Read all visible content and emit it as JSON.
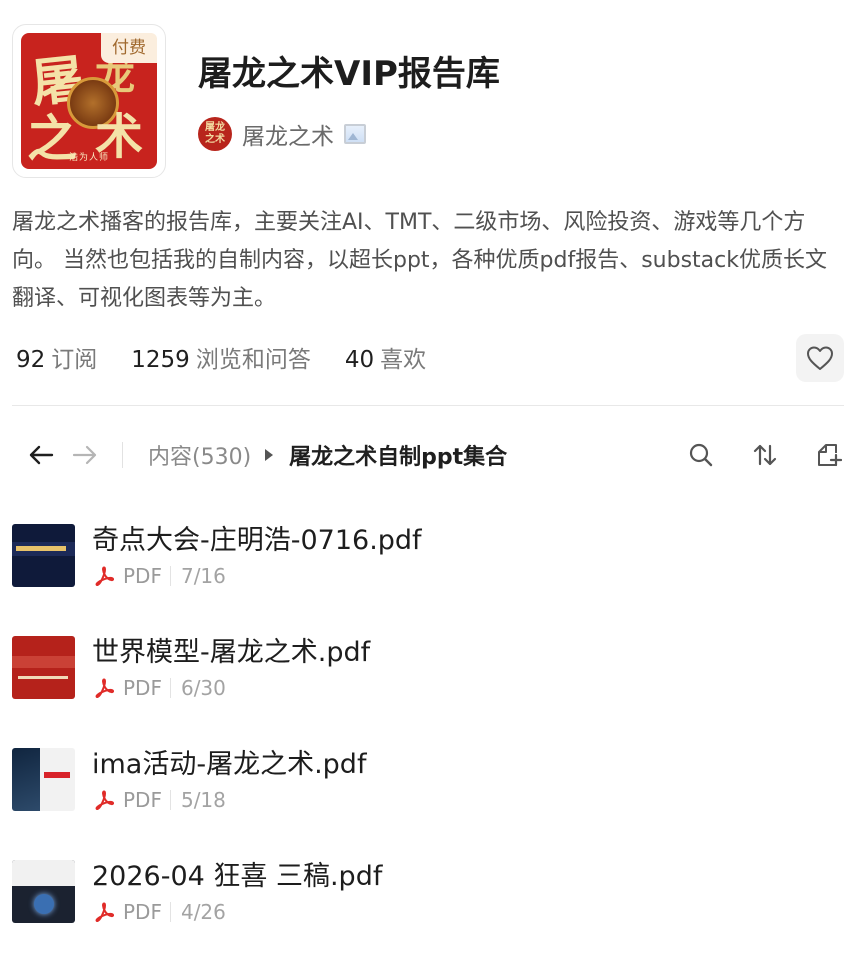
{
  "header": {
    "cover": {
      "chars": [
        "屠",
        "龙",
        "之",
        "术"
      ],
      "sub_text": "浩为人师",
      "paid_badge": "付费"
    },
    "title": "屠龙之术VIP报告库",
    "author": {
      "avatar_chars": [
        "屠龙",
        "之术"
      ],
      "name": "屠龙之术",
      "badge_icon": "image-icon"
    },
    "description": "屠龙之术播客的报告库，主要关注AI、TMT、二级市场、风险投资、游戏等几个方向。 当然也包括我的自制内容，以超长ppt，各种优质pdf报告、substack优质长文翻译、可视化图表等为主。"
  },
  "stats": [
    {
      "value": "92",
      "label": "订阅"
    },
    {
      "value": "1259",
      "label": "浏览和问答"
    },
    {
      "value": "40",
      "label": "喜欢"
    }
  ],
  "nav": {
    "back_icon": "arrow-left-icon",
    "forward_icon": "arrow-right-icon",
    "breadcrumb_root": "内容(530)",
    "breadcrumb_current": "屠龙之术自制ppt集合",
    "tools": [
      "search-icon",
      "sort-icon",
      "new-folder-icon"
    ]
  },
  "files": [
    {
      "name": "奇点大会-庄明浩-0716.pdf",
      "type": "PDF",
      "date": "7/16"
    },
    {
      "name": "世界模型-屠龙之术.pdf",
      "type": "PDF",
      "date": "6/30"
    },
    {
      "name": "ima活动-屠龙之术.pdf",
      "type": "PDF",
      "date": "5/18"
    },
    {
      "name": "2026-04 狂喜 三稿.pdf",
      "type": "PDF",
      "date": "4/26"
    }
  ],
  "colors": {
    "brand_red": "#c8231e",
    "pdf_red": "#e02b28",
    "muted_text": "#8a8a8a"
  }
}
